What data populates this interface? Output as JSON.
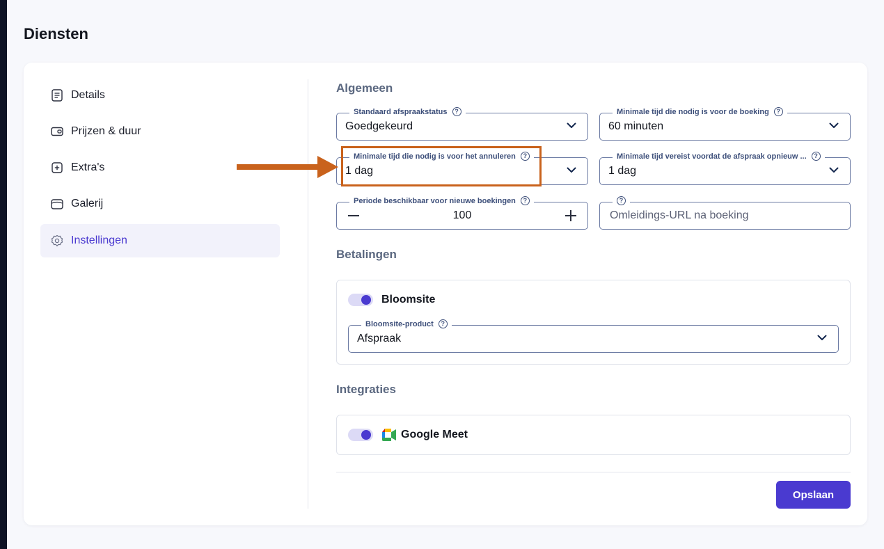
{
  "page": {
    "title": "Diensten"
  },
  "sidebar": {
    "items": [
      {
        "label": "Details",
        "icon": "document-icon"
      },
      {
        "label": "Prijzen & duur",
        "icon": "wallet-icon"
      },
      {
        "label": "Extra's",
        "icon": "plus-square-icon"
      },
      {
        "label": "Galerij",
        "icon": "gallery-icon"
      },
      {
        "label": "Instellingen",
        "icon": "gear-icon",
        "active": true
      }
    ]
  },
  "general": {
    "title": "Algemeen",
    "status": {
      "label": "Standaard afspraakstatus",
      "value": "Goedgekeurd"
    },
    "min_booking": {
      "label": "Minimale tijd die nodig is voor de boeking",
      "value": "60 minuten"
    },
    "min_cancel": {
      "label": "Minimale tijd die nodig is voor het annuleren",
      "value": "1 dag"
    },
    "min_reschedule": {
      "label": "Minimale tijd vereist voordat de afspraak opnieuw ...",
      "value": "1 dag"
    },
    "period": {
      "label": "Periode beschikbaar voor nieuwe boekingen",
      "value": "100"
    },
    "redirect": {
      "placeholder": "Omleidings-URL na boeking"
    }
  },
  "payments": {
    "title": "Betalingen",
    "provider": {
      "label": "Bloomsite",
      "enabled": true
    },
    "product": {
      "label": "Bloomsite-product",
      "value": "Afspraak"
    }
  },
  "integrations": {
    "title": "Integraties",
    "google_meet": {
      "label": "Google Meet",
      "enabled": true
    }
  },
  "actions": {
    "save_label": "Opslaan"
  },
  "colors": {
    "accent": "#4a3ad0",
    "annotation": "#c9621c"
  }
}
